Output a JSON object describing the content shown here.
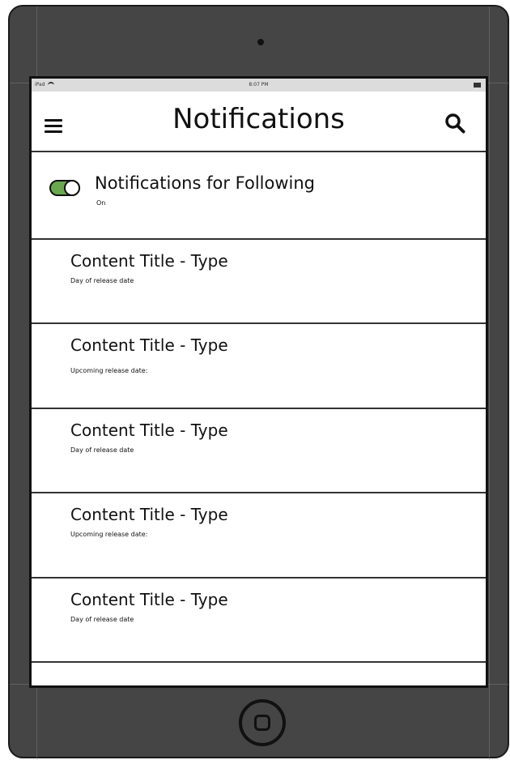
{
  "status_bar": {
    "carrier": "iPad",
    "time": "8:07 PM"
  },
  "header": {
    "title": "Notifications"
  },
  "following_toggle": {
    "label": "Notifications for Following",
    "state": "On",
    "accent": "#6aa84f"
  },
  "notifications": [
    {
      "title": "Content Title - Type",
      "subtitle": "Day of release date"
    },
    {
      "title": "Content Title - Type",
      "subtitle": "Upcoming release date:"
    },
    {
      "title": "Content Title - Type",
      "subtitle": "Day of release date"
    },
    {
      "title": "Content Title - Type",
      "subtitle": "Upcoming release date:"
    },
    {
      "title": "Content Title - Type",
      "subtitle": "Day of release date"
    }
  ]
}
